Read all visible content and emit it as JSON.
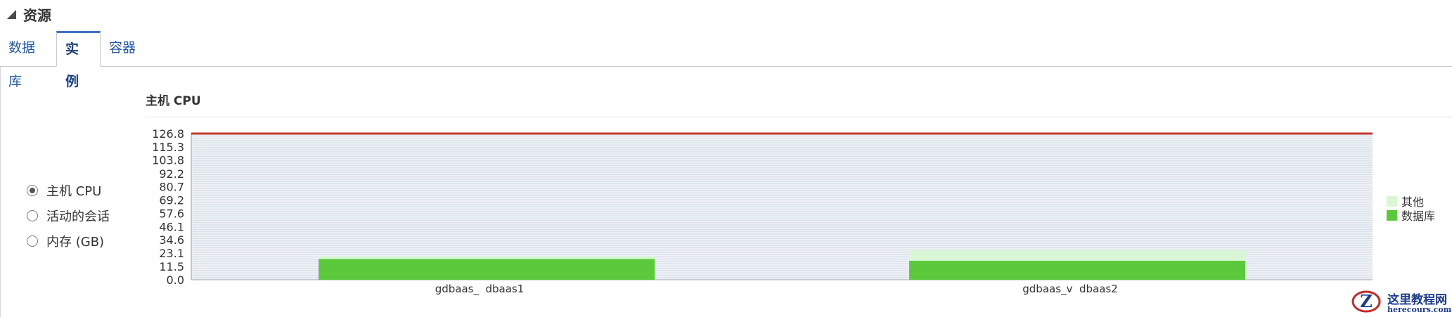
{
  "section": {
    "title": "资源",
    "collapse_icon": "triangle-collapse-icon"
  },
  "tabs": [
    {
      "label": "数据库",
      "active": false
    },
    {
      "label": "实例",
      "active": true
    },
    {
      "label": "容器",
      "active": false
    }
  ],
  "metric_options": [
    {
      "label": "主机 CPU",
      "selected": true
    },
    {
      "label": "活动的会话",
      "selected": false
    },
    {
      "label": "内存 (GB)",
      "selected": false
    }
  ],
  "chart_title": "主机 CPU",
  "chart_data": {
    "type": "bar",
    "stacked": true,
    "categories": [
      "gdbaas_  dbaas1",
      "gdbaas_v  dbaas2"
    ],
    "series": [
      {
        "name": "数据库",
        "values": [
          18,
          16.5
        ],
        "color": "#5cc93d"
      },
      {
        "name": "其他",
        "values": [
          2.5,
          9
        ],
        "color": "#d9f7d4"
      }
    ],
    "y_ticks": [
      "0.0",
      "11.5",
      "23.1",
      "34.6",
      "46.1",
      "57.6",
      "69.2",
      "80.7",
      "92.2",
      "103.8",
      "115.3",
      "126.8"
    ],
    "ylim": [
      0,
      126.8
    ],
    "limit_line": {
      "value": 126.8,
      "color": "#c0392b"
    },
    "legend_position": "right",
    "grid": true
  },
  "watermark": {
    "name": "这里教程网",
    "url": "herecours.com"
  }
}
